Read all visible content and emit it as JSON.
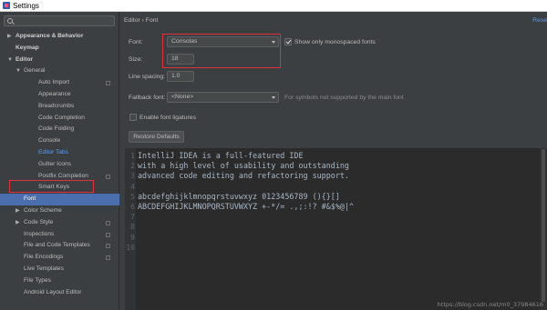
{
  "window": {
    "title": "Settings"
  },
  "sidebar": {
    "items": [
      {
        "label": "Appearance & Behavior",
        "indent": 0,
        "arrow": "▶",
        "bold": true
      },
      {
        "label": "Keymap",
        "indent": 0,
        "arrow": "",
        "bold": true
      },
      {
        "label": "Editor",
        "indent": 0,
        "arrow": "▼",
        "bold": true
      },
      {
        "label": "General",
        "indent": 1,
        "arrow": "▼",
        "bold": false
      },
      {
        "label": "Auto Import",
        "indent": 2,
        "arrow": "",
        "copy": true
      },
      {
        "label": "Appearance",
        "indent": 2,
        "arrow": ""
      },
      {
        "label": "Breadcrumbs",
        "indent": 2,
        "arrow": ""
      },
      {
        "label": "Code Completion",
        "indent": 2,
        "arrow": ""
      },
      {
        "label": "Code Folding",
        "indent": 2,
        "arrow": ""
      },
      {
        "label": "Console",
        "indent": 2,
        "arrow": ""
      },
      {
        "label": "Editor Tabs",
        "indent": 2,
        "arrow": "",
        "state": "active"
      },
      {
        "label": "Gutter Icons",
        "indent": 2,
        "arrow": ""
      },
      {
        "label": "Postfix Completion",
        "indent": 2,
        "arrow": "",
        "copy": true
      },
      {
        "label": "Smart Keys",
        "indent": 2,
        "arrow": ""
      },
      {
        "label": "Font",
        "indent": 1,
        "arrow": "",
        "state": "selected"
      },
      {
        "label": "Color Scheme",
        "indent": 1,
        "arrow": "▶"
      },
      {
        "label": "Code Style",
        "indent": 1,
        "arrow": "▶",
        "copy": true
      },
      {
        "label": "Inspections",
        "indent": 1,
        "arrow": "",
        "copy": true
      },
      {
        "label": "File and Code Templates",
        "indent": 1,
        "arrow": "",
        "copy": true
      },
      {
        "label": "File Encodings",
        "indent": 1,
        "arrow": "",
        "copy": true
      },
      {
        "label": "Live Templates",
        "indent": 1,
        "arrow": ""
      },
      {
        "label": "File Types",
        "indent": 1,
        "arrow": ""
      },
      {
        "label": "Android Layout Editor",
        "indent": 1,
        "arrow": ""
      }
    ]
  },
  "main": {
    "breadcrumb": "Editor  ›  Font",
    "reset_label": "Rese",
    "font_label": "Font:",
    "font_value": "Consolas",
    "mono_label": "Show only monospaced fonts",
    "size_label": "Size:",
    "size_value": "18",
    "spacing_label": "Line spacing:",
    "spacing_value": "1.0",
    "fallback_label": "Fallback font:",
    "fallback_value": "<None>",
    "fallback_hint": "For symbols not supported by the main font",
    "ligatures_label": "Enable font ligatures",
    "restore_label": "Restore Defaults"
  },
  "editor": {
    "lines": [
      {
        "num": "1",
        "text": "IntelliJ IDEA is a full-featured IDE"
      },
      {
        "num": "2",
        "text": "with a high level of usability and outstanding"
      },
      {
        "num": "3",
        "text": "advanced code editing and refactoring support."
      },
      {
        "num": "4",
        "text": ""
      },
      {
        "num": "5",
        "text": "abcdefghijklmnopqrstuvwxyz 0123456789 (){}[]"
      },
      {
        "num": "6",
        "text": "ABCDEFGHIJKLMNOPQRSTUVWXYZ +-*/= .,;:!? #&$%@|^"
      },
      {
        "num": "7",
        "text": ""
      },
      {
        "num": "8",
        "text": ""
      },
      {
        "num": "9",
        "text": ""
      },
      {
        "num": "10",
        "text": ""
      }
    ]
  },
  "watermark": "https://blog.csdn.net/m0_37984616"
}
